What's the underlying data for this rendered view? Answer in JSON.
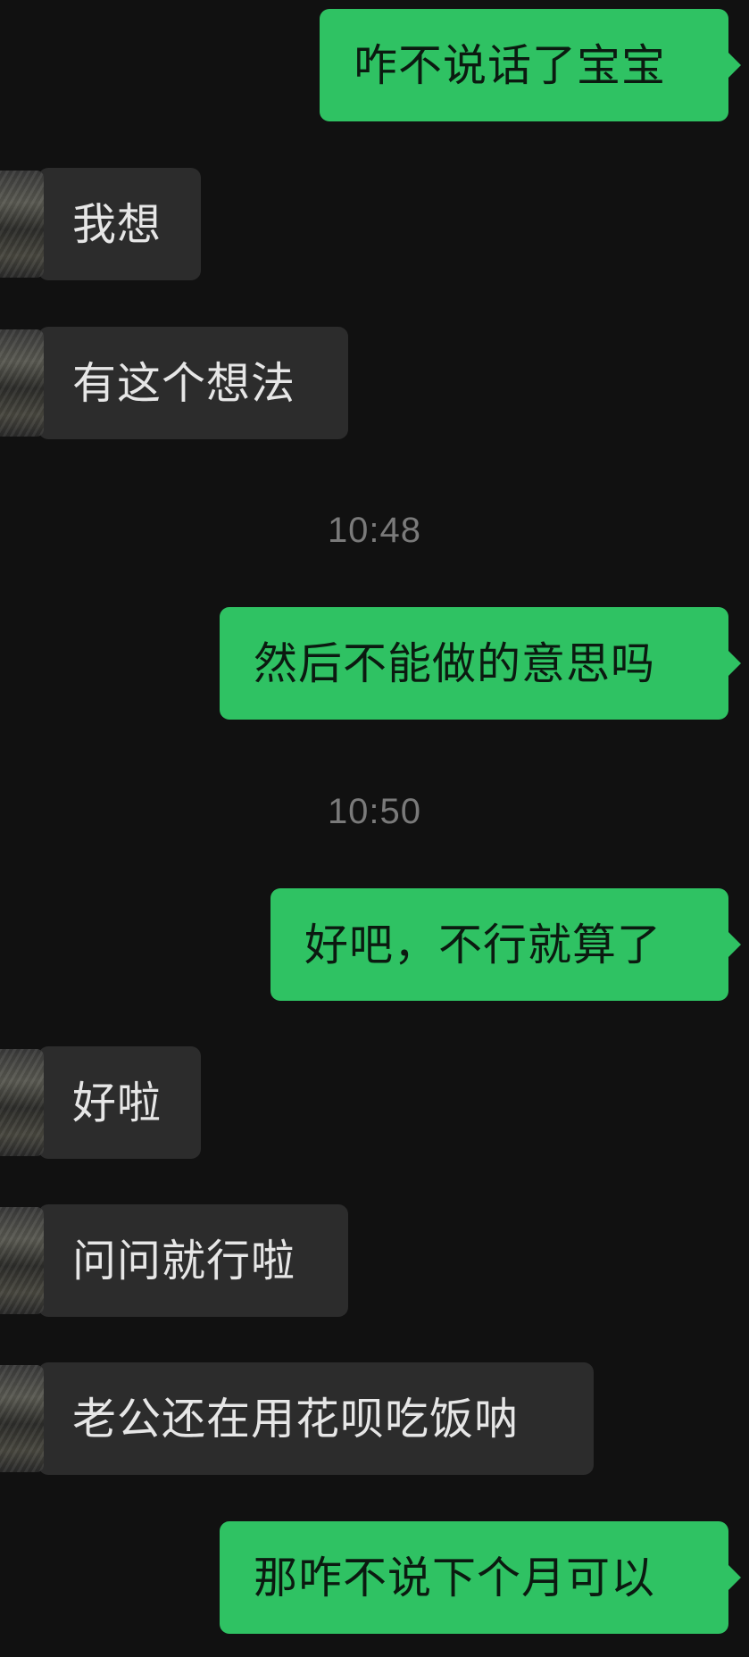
{
  "colors": {
    "background": "#111111",
    "outgoing_bubble": "#2fc263",
    "incoming_bubble": "#2c2c2c",
    "timestamp_text": "#7a7a7a"
  },
  "messages": [
    {
      "type": "outgoing",
      "text": "咋不说话了宝宝"
    },
    {
      "type": "incoming",
      "text": "我想"
    },
    {
      "type": "incoming",
      "text": "有这个想法"
    },
    {
      "type": "timestamp",
      "text": "10:48"
    },
    {
      "type": "outgoing",
      "text": "然后不能做的意思吗"
    },
    {
      "type": "timestamp",
      "text": "10:50"
    },
    {
      "type": "outgoing",
      "text": "好吧，不行就算了"
    },
    {
      "type": "incoming",
      "text": "好啦"
    },
    {
      "type": "incoming",
      "text": "问问就行啦"
    },
    {
      "type": "incoming",
      "text": "老公还在用花呗吃饭呐"
    },
    {
      "type": "outgoing",
      "text": "那咋不说下个月可以"
    }
  ]
}
